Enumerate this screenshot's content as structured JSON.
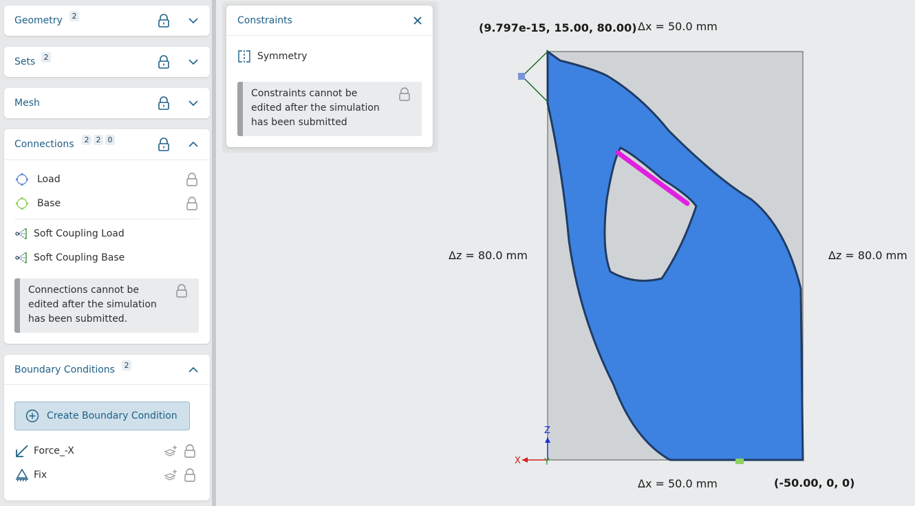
{
  "sidebar": {
    "geometry": {
      "title": "Geometry",
      "badges": [
        "2"
      ]
    },
    "sets": {
      "title": "Sets",
      "badges": [
        "2"
      ]
    },
    "mesh": {
      "title": "Mesh"
    },
    "connections": {
      "title": "Connections",
      "badges": [
        "2",
        "2",
        "0"
      ],
      "items": [
        {
          "label": "Load",
          "icon": "load-point-icon"
        },
        {
          "label": "Base",
          "icon": "base-point-icon"
        },
        {
          "label": "Soft Coupling Load",
          "icon": "soft-coupling-icon"
        },
        {
          "label": "Soft Coupling Base",
          "icon": "soft-coupling-icon"
        }
      ],
      "notice": "Connections cannot be edited after the simulation has been submitted."
    },
    "boundary_conditions": {
      "title": "Boundary Conditions",
      "badges": [
        "2"
      ],
      "create_label": "Create Boundary Condition",
      "items": [
        {
          "label": "Force_-X",
          "icon": "force-arrow-icon"
        },
        {
          "label": "Fix",
          "icon": "fix-support-icon"
        }
      ]
    }
  },
  "constraints_popup": {
    "title": "Constraints",
    "item": "Symmetry",
    "notice": "Constraints cannot be edited after the simulation has been submitted"
  },
  "viewport": {
    "top_dim": "Δx = 50.0 mm",
    "bottom_dim": "Δx = 50.0 mm",
    "left_dim": "Δz = 80.0 mm",
    "right_dim": "Δz = 80.0 mm",
    "top_coord": "(9.797e-15, 15.00, 80.00)",
    "bottom_coord": "(-50.00, 0, 0)",
    "axis_x": "X",
    "axis_y": "Y",
    "axis_z": "Z"
  },
  "colors": {
    "accent": "#1d5f85",
    "part": "#3b82e0",
    "load_line": "#e020e0"
  }
}
